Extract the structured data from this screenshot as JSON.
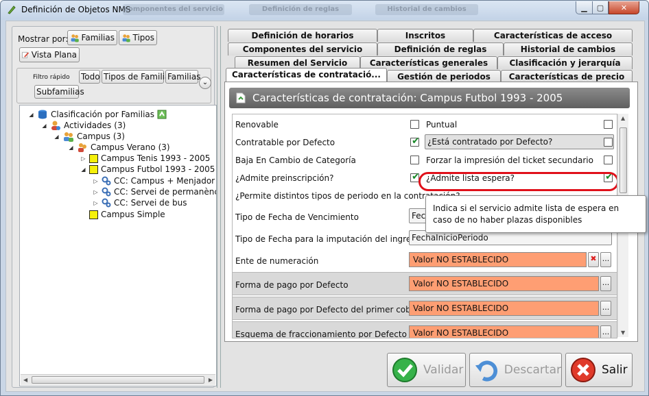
{
  "window": {
    "title": "Definición de Objetos NMS",
    "ghost_tabs": [
      "componentes del servicio",
      "Definición de reglas",
      "Historial de cambios"
    ]
  },
  "left": {
    "mostrar_label": "Mostrar por:",
    "btn_familias": "Familias",
    "btn_tipos": "Tipos",
    "btn_vista_plana": "Vista Plana",
    "filtro_label": "Filtro rápido",
    "filter_todo": "Todo",
    "filter_tipos_familia": "Tipos de Familia",
    "filter_familias": "Familias",
    "filter_subfamilias": "Subfamilias",
    "tree": [
      {
        "label": "Clasificación por Familias"
      },
      {
        "label": "Actividades",
        "count": "(3)"
      },
      {
        "label": "Campus",
        "count": "(3)"
      },
      {
        "label": "Campus Verano",
        "count": "(3)"
      },
      {
        "label": "Campus Tenis 1993 - 2005"
      },
      {
        "label": "Campus Futbol 1993 - 2005"
      },
      {
        "label": "CC: Campus + Menjador"
      },
      {
        "label": "CC: Servei de permanència"
      },
      {
        "label": "CC: Servei de bus"
      },
      {
        "label": "Campus Simple"
      }
    ]
  },
  "tabs": {
    "row1": [
      "Definición de horarios",
      "Inscritos",
      "Características de acceso"
    ],
    "row2": [
      "Componentes del servicio",
      "Definición de reglas",
      "Historial de cambios"
    ],
    "row3": [
      "Resumen del Servicio",
      "Características generales",
      "Clasificación y jerarquía"
    ],
    "row4": [
      "Características de contratació...",
      "Gestión de periodos",
      "Características de precio"
    ]
  },
  "panel": {
    "header": "Características de contratación: Campus Futbol 1993 - 2005",
    "renovable": "Renovable",
    "puntual": "Puntual",
    "contratable": "Contratable por Defecto",
    "esta_contratado": "¿Está contratado por Defecto?",
    "baja": "Baja En Cambio de Categoría",
    "forzar": "Forzar la impresión del ticket secundario",
    "admite_pre": "¿Admite preinscripción?",
    "admite_lista": "¿Admite lista espera?",
    "permite": "¿Permite distintos tipos de periodo en la contratación?",
    "tipo_fecha_venc": "Tipo de Fecha de Vencimiento",
    "tipo_fecha_venc_value": "Fec",
    "tipo_fecha_imput": "Tipo de Fecha para la imputación del ingreso",
    "tipo_fecha_imput_value": "FechaInicioPeriodo",
    "ente": "Ente de numeración",
    "forma_pago": "Forma de pago por Defecto",
    "forma_pago_primer": "Forma de pago por Defecto del primer cobro",
    "esquema": "Esquema de fraccionamiento por Defecto",
    "valor_no": "Valor NO ESTABLECIDO",
    "dots": "...",
    "tooltip": "Indica si el servicio admite lista de espera en caso de no haber plazas disponibles"
  },
  "buttons": {
    "validar": "Validar",
    "descartar": "Descartar",
    "salir": "Salir"
  },
  "colors": {
    "highlight": "#e0101a",
    "unset_value": "#fe9e73",
    "check": "#1a8a2a"
  }
}
